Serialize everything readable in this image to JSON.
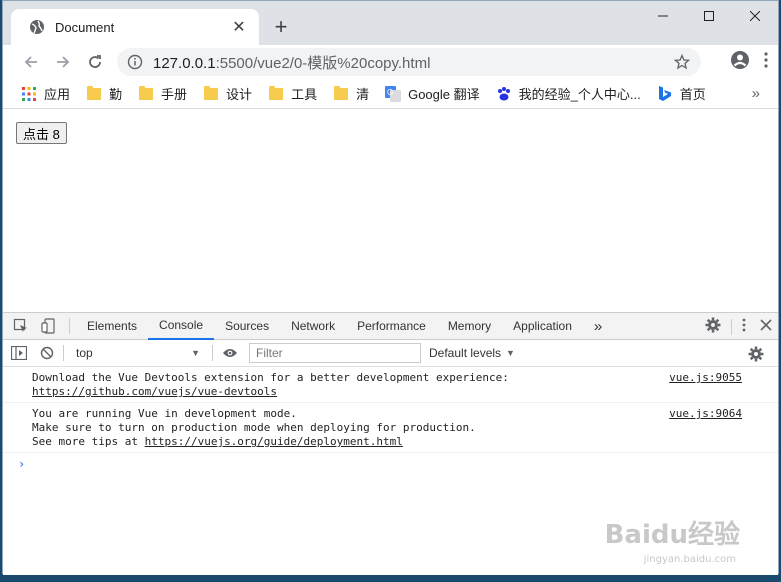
{
  "tab": {
    "title": "Document"
  },
  "omnibox": {
    "host": "127.0.0.1",
    "path": ":5500/vue2/0-模版%20copy.html"
  },
  "bookmarks": [
    {
      "label": "应用",
      "icon": "apps-grid-icon"
    },
    {
      "label": "勤",
      "icon": "folder-icon"
    },
    {
      "label": "手册",
      "icon": "folder-icon"
    },
    {
      "label": "设计",
      "icon": "folder-icon"
    },
    {
      "label": "工具",
      "icon": "folder-icon"
    },
    {
      "label": "清",
      "icon": "folder-icon"
    },
    {
      "label": "Google 翻译",
      "icon": "google-translate-icon"
    },
    {
      "label": "我的经验_个人中心...",
      "icon": "baidu-paw-icon"
    },
    {
      "label": "首页",
      "icon": "bing-icon"
    }
  ],
  "page": {
    "button_label": "点击 8"
  },
  "devtools": {
    "tabs": [
      "Elements",
      "Console",
      "Sources",
      "Network",
      "Performance",
      "Memory",
      "Application"
    ],
    "active_tab": "Console",
    "context": "top",
    "filter_placeholder": "Filter",
    "levels": "Default levels"
  },
  "console": {
    "messages": [
      {
        "lines": [
          "Download the Vue Devtools extension for a better development experience:"
        ],
        "link": "https://github.com/vuejs/vue-devtools",
        "source": "vue.js:9055"
      },
      {
        "lines": [
          "You are running Vue in development mode.",
          "Make sure to turn on production mode when deploying for production."
        ],
        "link_prefix": "See more tips at ",
        "link": "https://vuejs.org/guide/deployment.html",
        "source": "vue.js:9064"
      }
    ],
    "prompt": "›"
  },
  "watermark": {
    "text": "Baidu经验",
    "sub": "jingyan.baidu.com"
  },
  "colors": {
    "accent": "#1a73e8",
    "folder": "#f7cb4d",
    "titlebar": "#dee1e6"
  }
}
